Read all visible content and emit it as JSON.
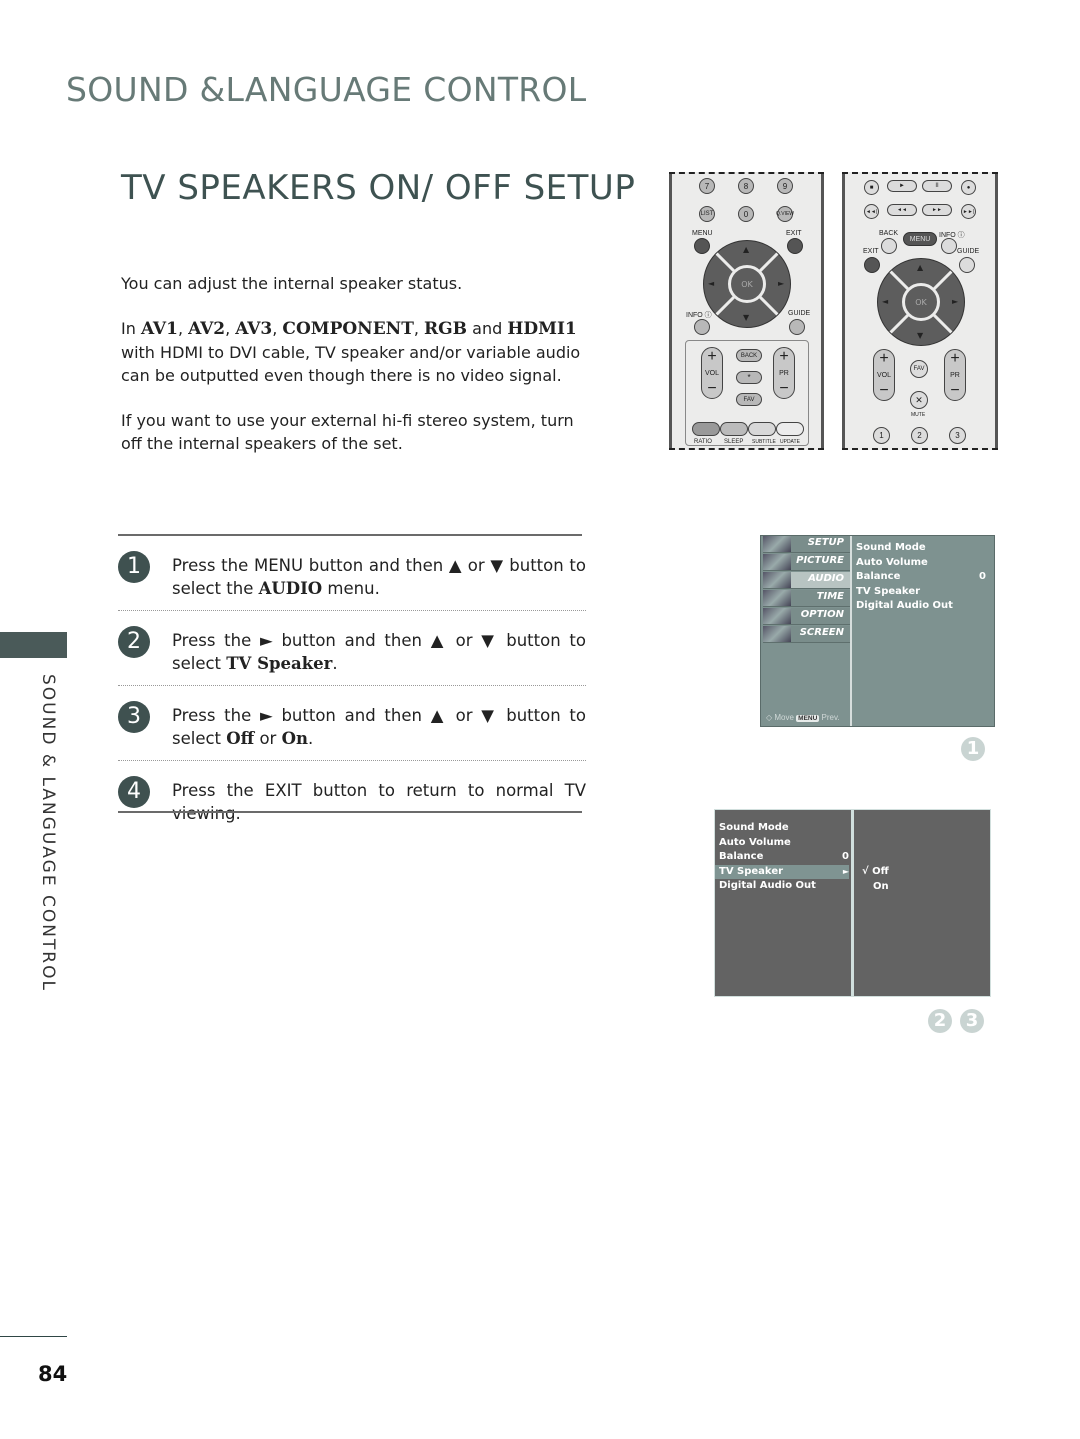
{
  "section_title": "SOUND &LANGUAGE CONTROL",
  "page_title": "TV SPEAKERS ON/ OFF SETUP",
  "intro": {
    "line1": "You can adjust the internal speaker status.",
    "line2_prefix": "In ",
    "inputs": [
      "AV1",
      "AV2",
      "AV3",
      "COMPONENT",
      "RGB",
      "HDMI1"
    ],
    "sep": ", ",
    "and": " and ",
    "line2_suffix": " with HDMI to DVI cable, TV speaker and/or variable audio can be outputted even though there is no video signal.",
    "line3": "If you want to use your external hi-fi stereo system, turn off the internal speakers of the set."
  },
  "steps": [
    {
      "num": "1",
      "a": "Press the ",
      "key": "MENU",
      "b": " button and then ▲ or ▼ button to select the ",
      "bold": "AUDIO",
      "c": " menu."
    },
    {
      "num": "2",
      "a": "Press the ► button and then ▲ or ▼ button to select ",
      "bold": "TV Speaker",
      "c": "."
    },
    {
      "num": "3",
      "a": "Press the ► button and then ▲ or ▼ button to select ",
      "bold1": "Off",
      "or": " or ",
      "bold2": "On",
      "c": "."
    },
    {
      "num": "4",
      "a": "Press the ",
      "key": "EXIT",
      "b": " button to return to normal TV viewing."
    }
  ],
  "side_label": "SOUND & LANGUAGE CONTROL",
  "page_number": "84",
  "remote1": {
    "row1": [
      "7",
      "8",
      "9"
    ],
    "row2": [
      "LIST",
      "0",
      "Q.VIEW"
    ],
    "menu": "MENU",
    "exit": "EXIT",
    "ok": "OK",
    "info": "INFO ⓘ",
    "guide": "GUIDE",
    "vol": "VOL",
    "pr": "PR",
    "back": "BACK",
    "star": "*",
    "fav": "FAV",
    "color_labels": [
      "RATIO",
      "SLEEP",
      "SUBTITLE",
      "UPDATE"
    ]
  },
  "remote2": {
    "transport1": [
      "■",
      "►",
      "II",
      "●"
    ],
    "transport2": [
      "◄◄|",
      "◄◄",
      "►►",
      "►►|"
    ],
    "back": "BACK",
    "menu": "MENU",
    "info": "INFO ⓘ",
    "exit": "EXIT",
    "guide": "GUIDE",
    "ok": "OK",
    "vol": "VOL",
    "pr": "PR",
    "fav": "FAV",
    "mute": "MUTE",
    "numbers": [
      "1",
      "2",
      "3"
    ]
  },
  "osd_audio": {
    "nav": [
      "SETUP",
      "PICTURE",
      "AUDIO",
      "TIME",
      "OPTION",
      "SCREEN"
    ],
    "active": "AUDIO",
    "items": [
      {
        "label": "Sound Mode",
        "value": ""
      },
      {
        "label": "Auto Volume",
        "value": ""
      },
      {
        "label": "Balance",
        "value": "0"
      },
      {
        "label": "TV Speaker",
        "value": ""
      },
      {
        "label": "Digital Audio Out",
        "value": ""
      }
    ],
    "footer_move": "◇ Move",
    "footer_key": "MENU",
    "footer_prev": "Prev."
  },
  "osd_speaker": {
    "items": [
      {
        "label": "Sound Mode",
        "value": ""
      },
      {
        "label": "Auto Volume",
        "value": ""
      },
      {
        "label": "Balance",
        "value": "0"
      },
      {
        "label": "TV Speaker",
        "value": "►"
      },
      {
        "label": "Digital Audio Out",
        "value": ""
      }
    ],
    "selected": "TV Speaker",
    "options": [
      "√ Off",
      "On"
    ],
    "checked": "Off"
  },
  "refs": {
    "fig1": [
      "1"
    ],
    "fig2": [
      "2",
      "3"
    ]
  }
}
